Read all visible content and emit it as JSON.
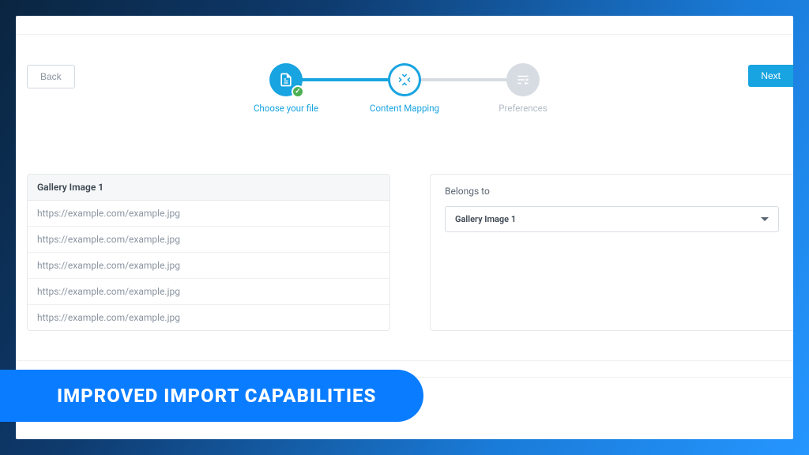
{
  "buttons": {
    "back": "Back",
    "next": "Next"
  },
  "stepper": {
    "steps": [
      {
        "label": "Choose your file",
        "state": "done"
      },
      {
        "label": "Content Mapping",
        "state": "active"
      },
      {
        "label": "Preferences",
        "state": "pending"
      }
    ]
  },
  "left_panel": {
    "header": "Gallery Image 1",
    "rows": [
      "https://example.com/example.jpg",
      "https://example.com/example.jpg",
      "https://example.com/example.jpg",
      "https://example.com/example.jpg",
      "https://example.com/example.jpg"
    ]
  },
  "right_panel": {
    "label": "Belongs to",
    "selected": "Gallery Image 1"
  },
  "banner": "Improved Import Capabilities"
}
